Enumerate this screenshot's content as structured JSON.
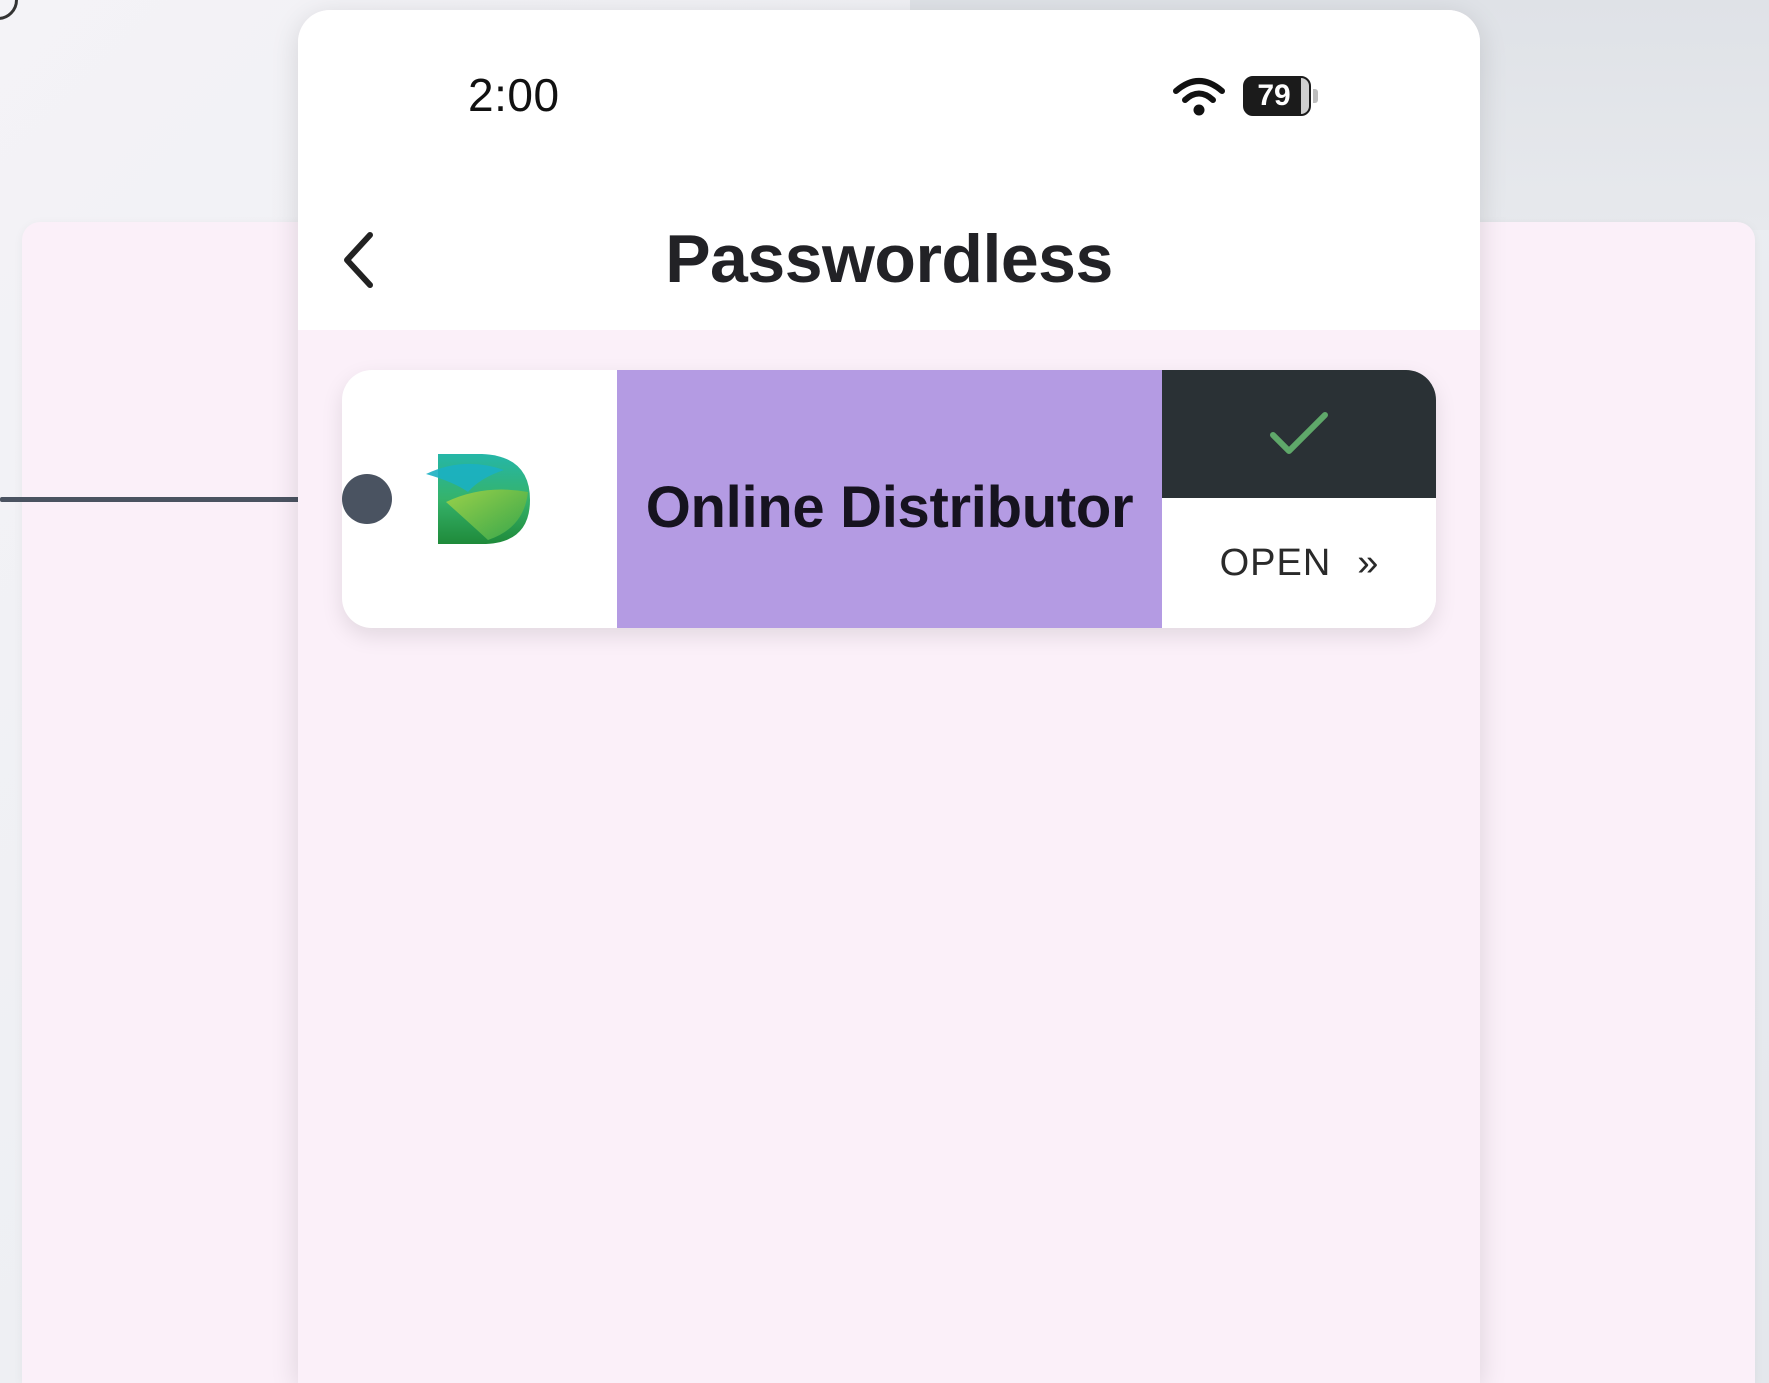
{
  "status_bar": {
    "time": "2:00",
    "battery_level": "79",
    "wifi_icon": "wifi-icon",
    "battery_icon": "battery-icon"
  },
  "header": {
    "title": "Passwordless",
    "back_icon": "chevron-left-icon"
  },
  "service": {
    "name": "Online Distributor",
    "status_icon": "checkmark-icon",
    "status_color": "#5fa86a",
    "open_label": "OPEN",
    "open_chevron": "»",
    "logo_icon": "online-distributor-logo"
  },
  "colors": {
    "name_cell": "#b49be3",
    "status_panel": "#2a3135",
    "background": "#fbf0f9",
    "connector": "#4a5361"
  }
}
